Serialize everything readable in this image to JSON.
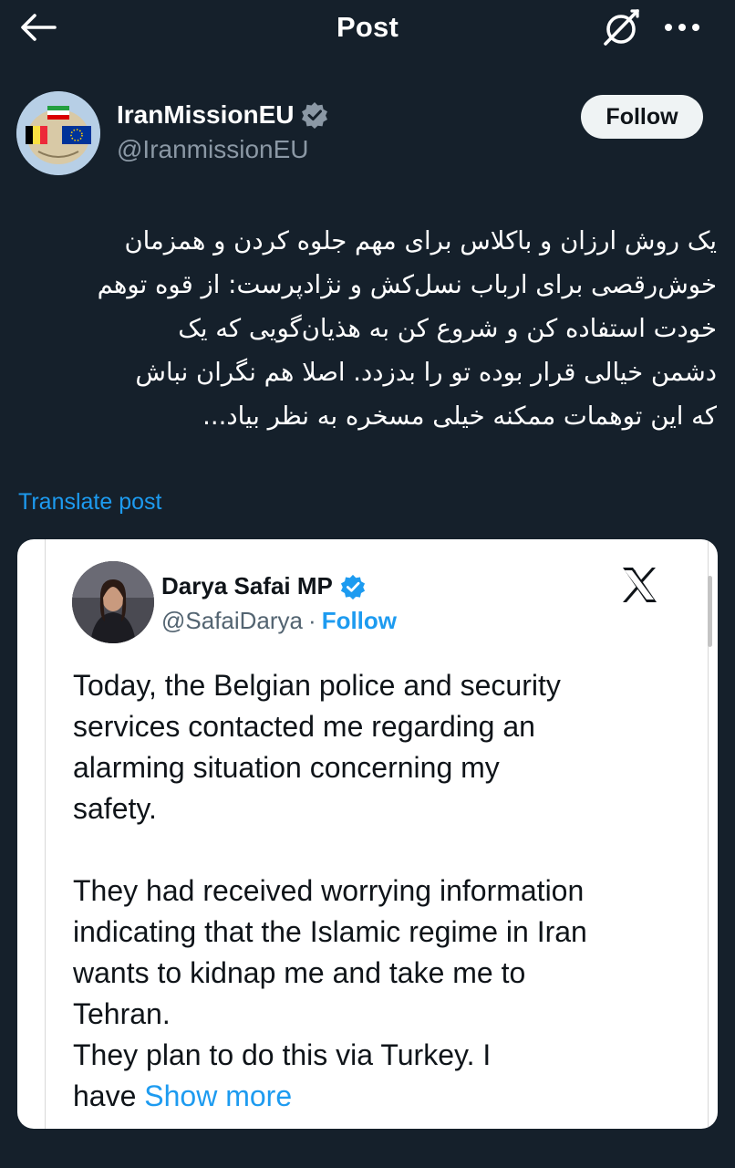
{
  "header": {
    "title": "Post",
    "back_icon": "back-arrow-icon",
    "grok_icon": "grok-icon",
    "more_icon": "more-icon"
  },
  "author": {
    "name": "IranMissionEU",
    "handle": "@IranmissionEU",
    "verified_icon": "verified-badge-icon",
    "follow_label": "Follow"
  },
  "post": {
    "text_lines": [
      "یک روش ارزان و باکلاس برای مهم جلوه کردن و همزمان",
      "خوش‌رقصی برای ارباب نسل‌کش و نژادپرست: از قوه توهم",
      "خودت استفاده کن و شروع کن به هذیان‌گویی که یک",
      "دشمن خیالی قرار بوده تو را بدزدد. اصلا هم نگران نباش",
      "که این توهمات ممکنه خیلی مسخره به نظر بیاد..."
    ],
    "translate_label": "Translate post"
  },
  "embedded": {
    "name": "Darya Safai MP",
    "handle": "@SafaiDarya",
    "separator": "·",
    "follow_label": "Follow",
    "logo_icon": "x-logo-icon",
    "text_lines": [
      "Today, the Belgian police and security",
      "services contacted me regarding an",
      "alarming situation concerning my",
      "safety.",
      "",
      "They had received worrying information",
      "indicating that the Islamic regime in Iran",
      "wants to kidnap me and take me to",
      "Tehran.",
      "They plan to do this via Turkey. I"
    ],
    "last_line_prefix": "have",
    "show_more_label": "Show more"
  },
  "colors": {
    "background": "#15202b",
    "accent": "#1d9bf0",
    "secondary_text": "#8b98a5",
    "verified": "#1d9bf0"
  }
}
